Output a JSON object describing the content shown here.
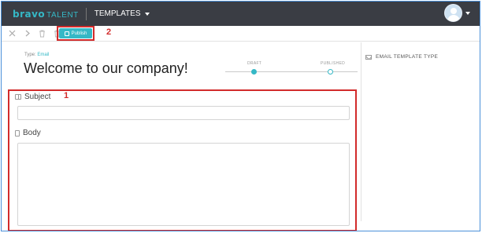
{
  "app": {
    "logo_bravo": "bravo",
    "logo_talent": "TALENT",
    "nav_menu_label": "TEMPLATES",
    "accent_color": "#35b8c6",
    "topbar_color": "#3a3d44"
  },
  "toolbar": {
    "icons": [
      "close-icon",
      "chevron-right-icon",
      "trash-icon",
      "trash-icon"
    ],
    "publish_label": "Publish"
  },
  "annotations": {
    "form_marker": "1",
    "publish_marker": "2",
    "highlight_color": "#d22b2b"
  },
  "template": {
    "type_label": "Type:",
    "type_value": "Email",
    "title": "Welcome to our company!"
  },
  "status_stepper": {
    "steps": [
      {
        "label": "DRAFT",
        "active": true
      },
      {
        "label": "PUBLISHED",
        "active": false
      }
    ]
  },
  "form": {
    "subject_label": "Subject",
    "subject_value": "",
    "body_label": "Body",
    "body_value": ""
  },
  "side_panel": {
    "heading": "EMAIL TEMPLATE TYPE"
  }
}
